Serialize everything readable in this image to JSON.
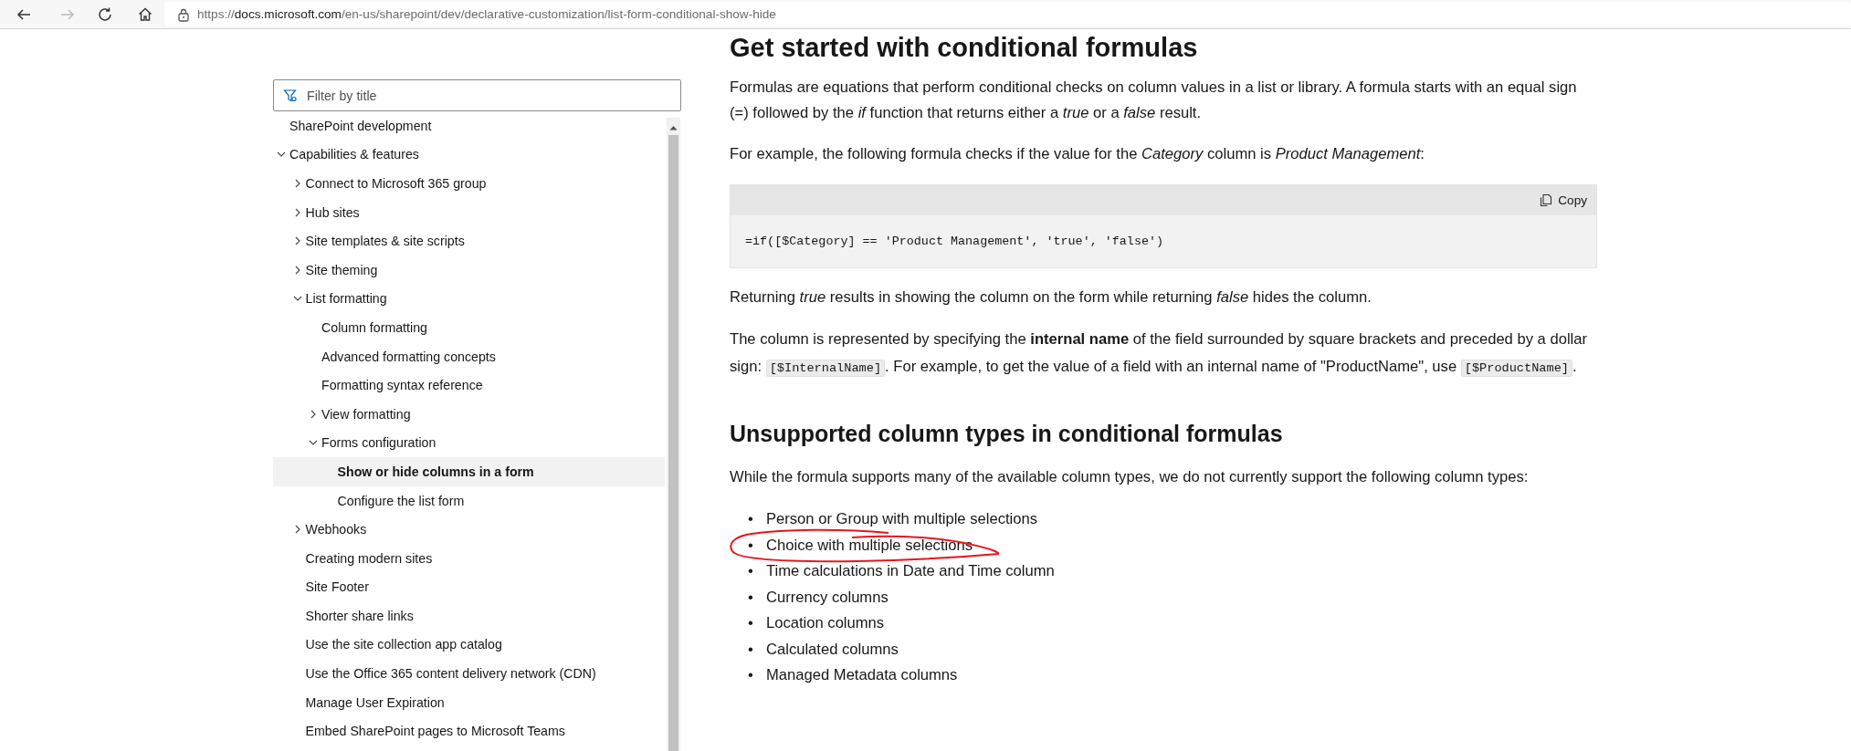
{
  "browser": {
    "url": {
      "scheme": "https://",
      "host": "docs.microsoft.com",
      "path": "/en-us/sharepoint/dev/declarative-customization/list-form-conditional-show-hide"
    },
    "forward_disabled": true
  },
  "sidebar": {
    "filter": {
      "placeholder": "Filter by title"
    },
    "tree": [
      {
        "label": "SharePoint development",
        "kind": "page",
        "selected": false
      },
      {
        "label": "Capabilities & features",
        "kind": "group",
        "expanded": true,
        "selected": false,
        "children": [
          {
            "label": "Connect to Microsoft 365 group",
            "kind": "group",
            "expanded": false,
            "selected": false
          },
          {
            "label": "Hub sites",
            "kind": "group",
            "expanded": false,
            "selected": false
          },
          {
            "label": "Site templates & site scripts",
            "kind": "group",
            "expanded": false,
            "selected": false
          },
          {
            "label": "Site theming",
            "kind": "group",
            "expanded": false,
            "selected": false
          },
          {
            "label": "List formatting",
            "kind": "group",
            "expanded": true,
            "selected": false,
            "children": [
              {
                "label": "Column formatting",
                "kind": "page",
                "selected": false
              },
              {
                "label": "Advanced formatting concepts",
                "kind": "page",
                "selected": false
              },
              {
                "label": "Formatting syntax reference",
                "kind": "page",
                "selected": false
              },
              {
                "label": "View formatting",
                "kind": "group",
                "expanded": false,
                "selected": false
              },
              {
                "label": "Forms configuration",
                "kind": "group",
                "expanded": true,
                "selected": false,
                "children": [
                  {
                    "label": "Show or hide columns in a form",
                    "kind": "page",
                    "selected": true
                  },
                  {
                    "label": "Configure the list form",
                    "kind": "page",
                    "selected": false
                  }
                ]
              }
            ]
          },
          {
            "label": "Webhooks",
            "kind": "group",
            "expanded": false,
            "selected": false
          },
          {
            "label": "Creating modern sites",
            "kind": "page",
            "selected": false
          },
          {
            "label": "Site Footer",
            "kind": "page",
            "selected": false
          },
          {
            "label": "Shorter share links",
            "kind": "page",
            "selected": false
          },
          {
            "label": "Use the site collection app catalog",
            "kind": "page",
            "selected": false
          },
          {
            "label": "Use the Office 365 content delivery network (CDN)",
            "kind": "page",
            "selected": false
          },
          {
            "label": "Manage User Expiration",
            "kind": "page",
            "selected": false
          },
          {
            "label": "Embed SharePoint pages to Microsoft Teams",
            "kind": "page",
            "selected": false
          }
        ]
      }
    ]
  },
  "article": {
    "blocks": [
      {
        "kind": "h1",
        "text": "Get started with conditional formulas"
      },
      {
        "kind": "p",
        "parts": [
          {
            "kind": "text",
            "text": "Formulas are equations that perform conditional checks on column values in a list or library. A formula starts with an equal sign (=) followed by the *if* function that returns either a *true* or a *false* result."
          }
        ]
      },
      {
        "kind": "p",
        "parts": [
          {
            "kind": "text",
            "text": "For example, the following formula checks if the value for the *Category* column is *Product Management*:"
          }
        ]
      },
      {
        "kind": "code",
        "copy_label": "Copy",
        "code": "=if([$Category] == 'Product Management', 'true', 'false')"
      },
      {
        "kind": "p",
        "parts": [
          {
            "kind": "text",
            "text": "Returning *true* results in showing the column on the form while returning *false* hides the column."
          }
        ]
      },
      {
        "kind": "p",
        "parts": [
          {
            "kind": "text",
            "text": "The column is represented by specifying the **internal name** of the field surrounded by square brackets and preceded by a dollar sign: "
          },
          {
            "kind": "code",
            "text": "[$InternalName]"
          },
          {
            "kind": "text",
            "text": ". For example, to get the value of a field with an internal name of \"ProductName\", use "
          },
          {
            "kind": "code",
            "text": "[$ProductName]"
          },
          {
            "kind": "text",
            "text": "."
          }
        ]
      },
      {
        "kind": "h2",
        "text": "Unsupported column types in conditional formulas"
      },
      {
        "kind": "p",
        "parts": [
          {
            "kind": "text",
            "text": "While the formula supports many of the available column types, we do not currently support the following column types:"
          }
        ]
      },
      {
        "kind": "list",
        "bullet": "•",
        "items": [
          {
            "text": "Person or Group with multiple selections",
            "circled": false
          },
          {
            "text": "Choice with multiple selections",
            "circled": true
          },
          {
            "text": "Time calculations in Date and Time column",
            "circled": false
          },
          {
            "text": "Currency columns",
            "circled": false
          },
          {
            "text": "Location columns",
            "circled": false
          },
          {
            "text": "Calculated columns",
            "circled": false
          },
          {
            "text": "Managed Metadata columns",
            "circled": false
          }
        ]
      }
    ]
  }
}
